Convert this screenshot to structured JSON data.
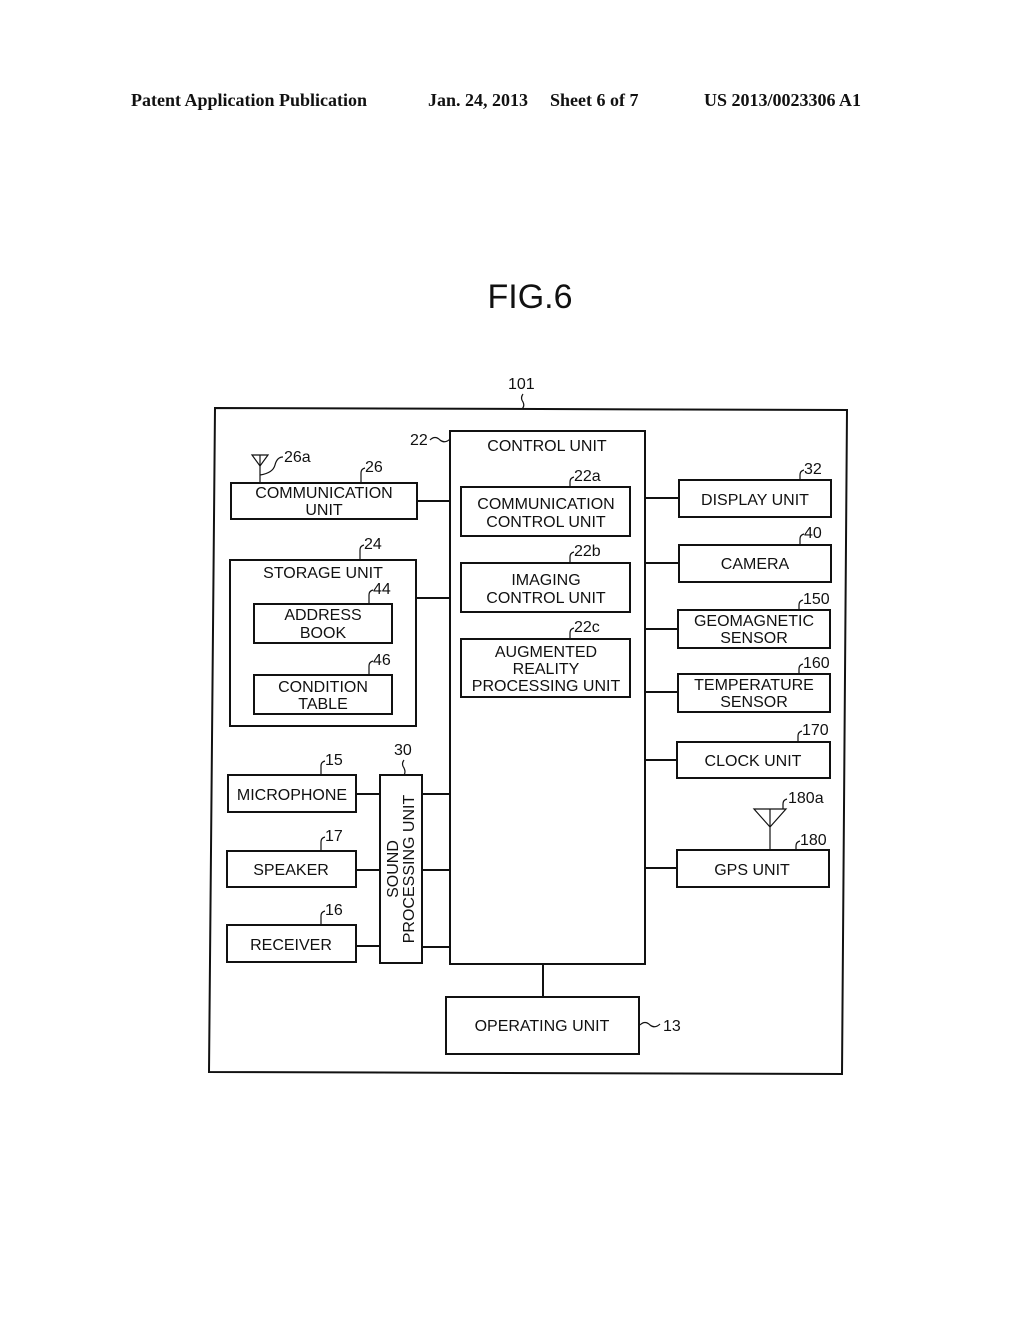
{
  "header": {
    "publication_type": "Patent Application Publication",
    "date": "Jan. 24, 2013",
    "sheet": "Sheet 6 of 7",
    "number": "US 2013/0023306 A1"
  },
  "figure": {
    "title": "FIG.6",
    "device_ref": "101",
    "control_unit": {
      "ref": "22",
      "label": "CONTROL UNIT",
      "sub_units": [
        {
          "ref": "22a",
          "lines": [
            "COMMUNICATION",
            "CONTROL UNIT"
          ]
        },
        {
          "ref": "22b",
          "lines": [
            "IMAGING",
            "CONTROL UNIT"
          ]
        },
        {
          "ref": "22c",
          "lines": [
            "AUGMENTED",
            "REALITY",
            "PROCESSING UNIT"
          ]
        }
      ]
    },
    "communication_unit": {
      "ref": "26",
      "lines": [
        "COMMUNICATION",
        "UNIT"
      ],
      "antenna_ref": "26a"
    },
    "storage_unit": {
      "ref": "24",
      "label": "STORAGE UNIT",
      "items": [
        {
          "ref": "44",
          "lines": [
            "ADDRESS",
            "BOOK"
          ]
        },
        {
          "ref": "46",
          "lines": [
            "CONDITION",
            "TABLE"
          ]
        }
      ]
    },
    "sound_processing_unit": {
      "ref": "30",
      "lines": [
        "SOUND",
        "PROCESSING UNIT"
      ]
    },
    "audio_devices": [
      {
        "ref": "15",
        "label": "MICROPHONE"
      },
      {
        "ref": "17",
        "label": "SPEAKER"
      },
      {
        "ref": "16",
        "label": "RECEIVER"
      }
    ],
    "right_units": [
      {
        "ref": "32",
        "lines": [
          "DISPLAY UNIT"
        ]
      },
      {
        "ref": "40",
        "lines": [
          "CAMERA"
        ]
      },
      {
        "ref": "150",
        "lines": [
          "GEOMAGNETIC",
          "SENSOR"
        ]
      },
      {
        "ref": "160",
        "lines": [
          "TEMPERATURE",
          "SENSOR"
        ]
      },
      {
        "ref": "170",
        "lines": [
          "CLOCK UNIT"
        ]
      },
      {
        "ref": "180",
        "lines": [
          "GPS UNIT"
        ],
        "antenna_ref": "180a"
      }
    ],
    "operating_unit": {
      "ref": "13",
      "label": "OPERATING UNIT"
    }
  }
}
